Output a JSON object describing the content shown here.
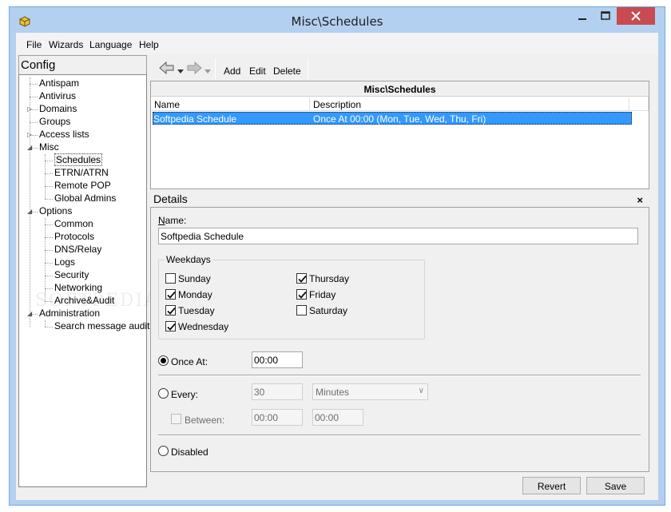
{
  "window": {
    "title": "Misc\\Schedules"
  },
  "menu": {
    "items": [
      "File",
      "Wizards",
      "Language",
      "Help"
    ]
  },
  "config": {
    "header": "Config",
    "tree": [
      {
        "label": "Antispam",
        "level": 0,
        "expander": ""
      },
      {
        "label": "Antivirus",
        "level": 0,
        "expander": ""
      },
      {
        "label": "Domains",
        "level": 0,
        "expander": "collapsed"
      },
      {
        "label": "Groups",
        "level": 0,
        "expander": ""
      },
      {
        "label": "Access lists",
        "level": 0,
        "expander": "collapsed"
      },
      {
        "label": "Misc",
        "level": 0,
        "expander": "expanded"
      },
      {
        "label": "Schedules",
        "level": 1,
        "expander": "",
        "selected": true
      },
      {
        "label": "ETRN/ATRN",
        "level": 1,
        "expander": ""
      },
      {
        "label": "Remote POP",
        "level": 1,
        "expander": ""
      },
      {
        "label": "Global Admins",
        "level": 1,
        "expander": ""
      },
      {
        "label": "Options",
        "level": 0,
        "expander": "expanded"
      },
      {
        "label": "Common",
        "level": 1,
        "expander": ""
      },
      {
        "label": "Protocols",
        "level": 1,
        "expander": ""
      },
      {
        "label": "DNS/Relay",
        "level": 1,
        "expander": ""
      },
      {
        "label": "Logs",
        "level": 1,
        "expander": ""
      },
      {
        "label": "Security",
        "level": 1,
        "expander": ""
      },
      {
        "label": "Networking",
        "level": 1,
        "expander": ""
      },
      {
        "label": "Archive&Audit",
        "level": 1,
        "expander": ""
      },
      {
        "label": "Administration",
        "level": 0,
        "expander": "expanded"
      },
      {
        "label": "Search message audit",
        "level": 1,
        "expander": ""
      }
    ]
  },
  "toolbar": {
    "add_label": "Add",
    "edit_label": "Edit",
    "delete_label": "Delete"
  },
  "list": {
    "title": "Misc\\Schedules",
    "columns": [
      "Name",
      "Description"
    ],
    "rows": [
      {
        "name": "Softpedia Schedule",
        "description": "Once At 00:00 (Mon, Tue, Wed, Thu, Fri)"
      }
    ]
  },
  "details": {
    "header": "Details",
    "close_glyph": "×",
    "name_label": "Name:",
    "name_value": "Softpedia Schedule",
    "weekdays_label": "Weekdays",
    "weekdays": [
      {
        "label": "Sunday",
        "checked": false
      },
      {
        "label": "Monday",
        "checked": true
      },
      {
        "label": "Tuesday",
        "checked": true
      },
      {
        "label": "Wednesday",
        "checked": true
      },
      {
        "label": "Thursday",
        "checked": true
      },
      {
        "label": "Friday",
        "checked": true
      },
      {
        "label": "Saturday",
        "checked": false
      }
    ],
    "once_at_label": "Once At:",
    "once_at_value": "00:00",
    "every_label": "Every:",
    "every_value": "30",
    "every_unit": "Minutes",
    "between_label": "Between:",
    "between_from": "00:00",
    "between_to": "00:00",
    "disabled_label": "Disabled",
    "mode": "once"
  },
  "buttons": {
    "revert_label": "Revert",
    "save_label": "Save"
  },
  "colors": {
    "selection": "#3399ff",
    "close_button": "#c74b50",
    "frame": "#b3d0f0"
  }
}
